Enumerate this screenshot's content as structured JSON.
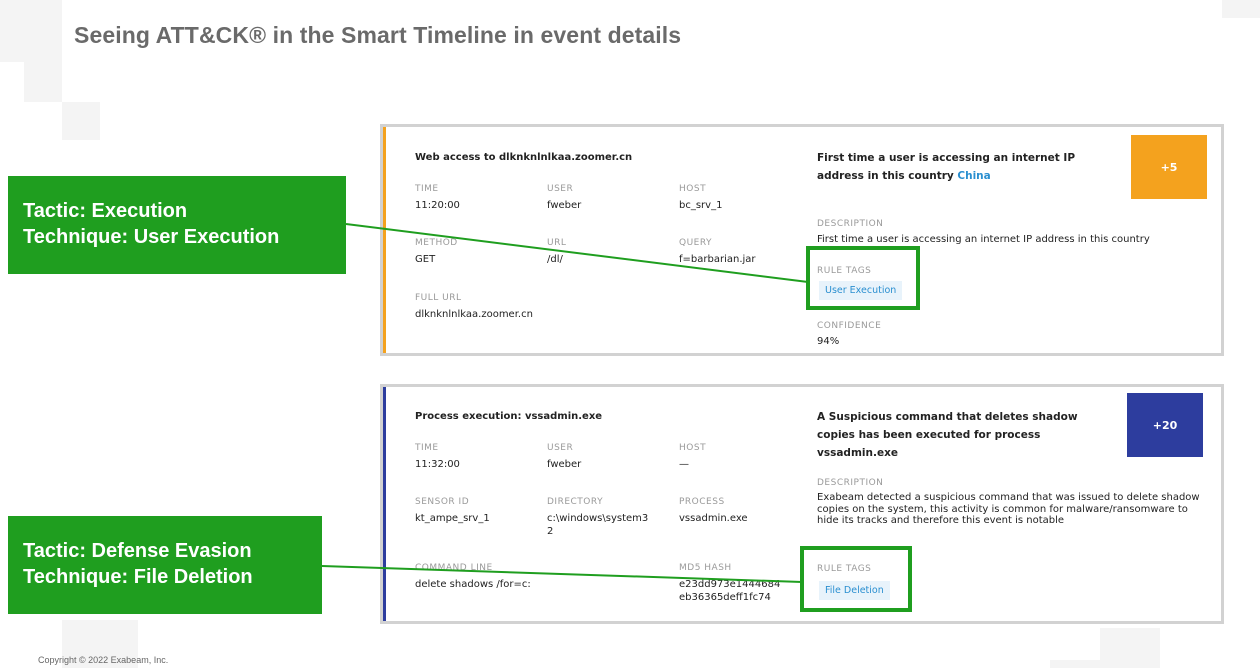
{
  "slide": {
    "title": "Seeing ATT&CK® in the Smart Timeline in event details",
    "copyright": "Copyright © 2022 Exabeam, Inc."
  },
  "callouts": [
    {
      "tactic": "Tactic: Execution",
      "technique": "Technique: User Execution"
    },
    {
      "tactic": "Tactic: Defense Evasion",
      "technique": "Technique: File Deletion"
    }
  ],
  "colors": {
    "green": "#1f9e1f",
    "orange": "#f4a21e",
    "navy": "#2d3d9e",
    "link": "#2a8fd0"
  },
  "events": [
    {
      "title": "Web access to dlknknlnlkaa.zoomer.cn",
      "fields": [
        {
          "label": "TIME",
          "value": "11:20:00"
        },
        {
          "label": "USER",
          "value": "fweber"
        },
        {
          "label": "HOST",
          "value": "bc_srv_1"
        },
        {
          "label": "METHOD",
          "value": "GET"
        },
        {
          "label": "URL",
          "value": "/dl/"
        },
        {
          "label": "QUERY",
          "value": "f=barbarian.jar"
        },
        {
          "label": "FULL URL",
          "value": "dlknknlnlkaa.zoomer.cn"
        }
      ],
      "headline": "First time a user is accessing an internet IP address in this country",
      "headline_link": "China",
      "score": "+5",
      "description_label": "DESCRIPTION",
      "description": "First time a user is accessing an internet IP address in this country",
      "rule_tags_label": "RULE TAGS",
      "rule_tag": "User Execution",
      "confidence_label": "CONFIDENCE",
      "confidence": "94%"
    },
    {
      "title": "Process execution: vssadmin.exe",
      "fields": [
        {
          "label": "TIME",
          "value": "11:32:00"
        },
        {
          "label": "USER",
          "value": "fweber"
        },
        {
          "label": "HOST",
          "value": "—"
        },
        {
          "label": "SENSOR ID",
          "value": "kt_ampe_srv_1"
        },
        {
          "label": "DIRECTORY",
          "value": "c:\\windows\\system32"
        },
        {
          "label": "PROCESS",
          "value": "vssadmin.exe"
        },
        {
          "label": "COMMAND LINE",
          "value": "delete shadows /for=c:"
        },
        {
          "label": "MD5 HASH",
          "value": "e23dd973e1444684eb36365deff1fc74"
        }
      ],
      "headline": "A Suspicious command that deletes shadow copies has been executed for process vssadmin.exe",
      "score": "+20",
      "description_label": "DESCRIPTION",
      "description": "Exabeam detected a suspicious command that was issued to delete shadow copies on the system, this activity is common for malware/ransomware to hide its tracks and therefore this event is notable",
      "rule_tags_label": "RULE TAGS",
      "rule_tag": "File Deletion"
    }
  ]
}
